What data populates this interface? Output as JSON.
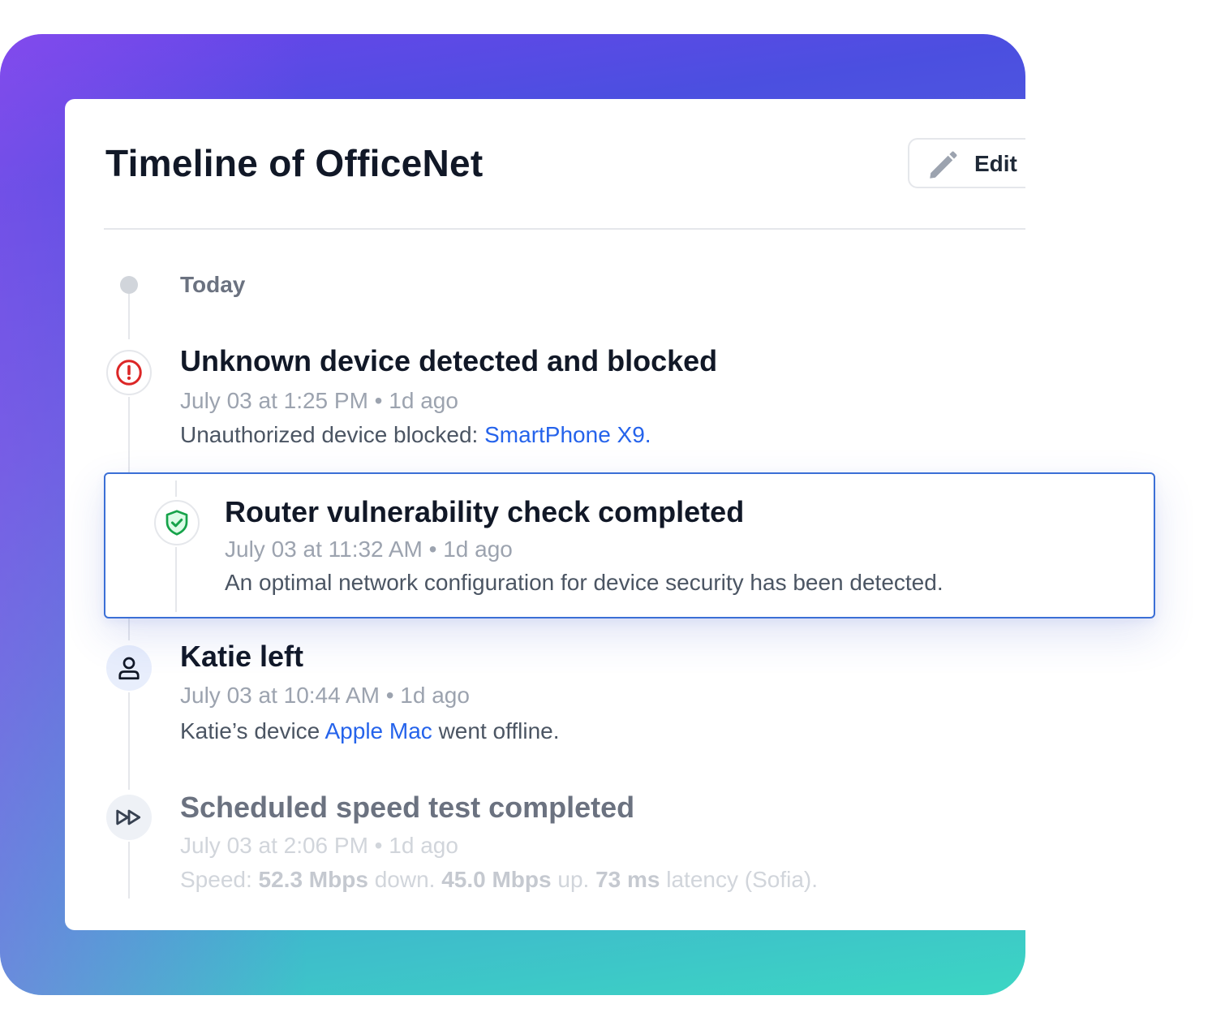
{
  "card": {
    "title": "Timeline of OfficeNet",
    "edit_label": "Edit"
  },
  "timeline": {
    "group_label": "Today",
    "events": [
      {
        "title": "Unknown device detected and blocked",
        "time": "July 03 at 1:25 PM • 1d ago",
        "desc_prefix": "Unauthorized device blocked: ",
        "desc_link": "SmartPhone X9.",
        "icon": "alert-circle-icon",
        "icon_color": "#dc2626"
      },
      {
        "title": "Router vulnerability check completed",
        "time": "July 03 at 11:32 AM • 1d ago",
        "desc": "An optimal network configuration for device security has been detected.",
        "icon": "shield-check-icon",
        "icon_color": "#16a34a"
      },
      {
        "title": "Katie left",
        "time": "July 03 at 10:44 AM • 1d ago",
        "desc_prefix": "Katie’s device ",
        "desc_link": "Apple Mac",
        "desc_suffix": " went offline.",
        "icon": "user-icon",
        "icon_color": "#111827"
      },
      {
        "title": "Scheduled speed test completed",
        "time": "July 03 at 2:06 PM • 1d ago",
        "desc_parts": [
          "Speed: ",
          "52.3 Mbps",
          " down. ",
          "45.0 Mbps",
          " up. ",
          "73 ms",
          " latency (Sofia)."
        ],
        "icon": "fast-forward-icon",
        "icon_color": "#374151"
      }
    ]
  },
  "colors": {
    "link": "#2563eb",
    "highlight_border": "#3b6fd6",
    "gradient_top": "#6a45ea",
    "gradient_bottom": "#3cd6c3"
  }
}
